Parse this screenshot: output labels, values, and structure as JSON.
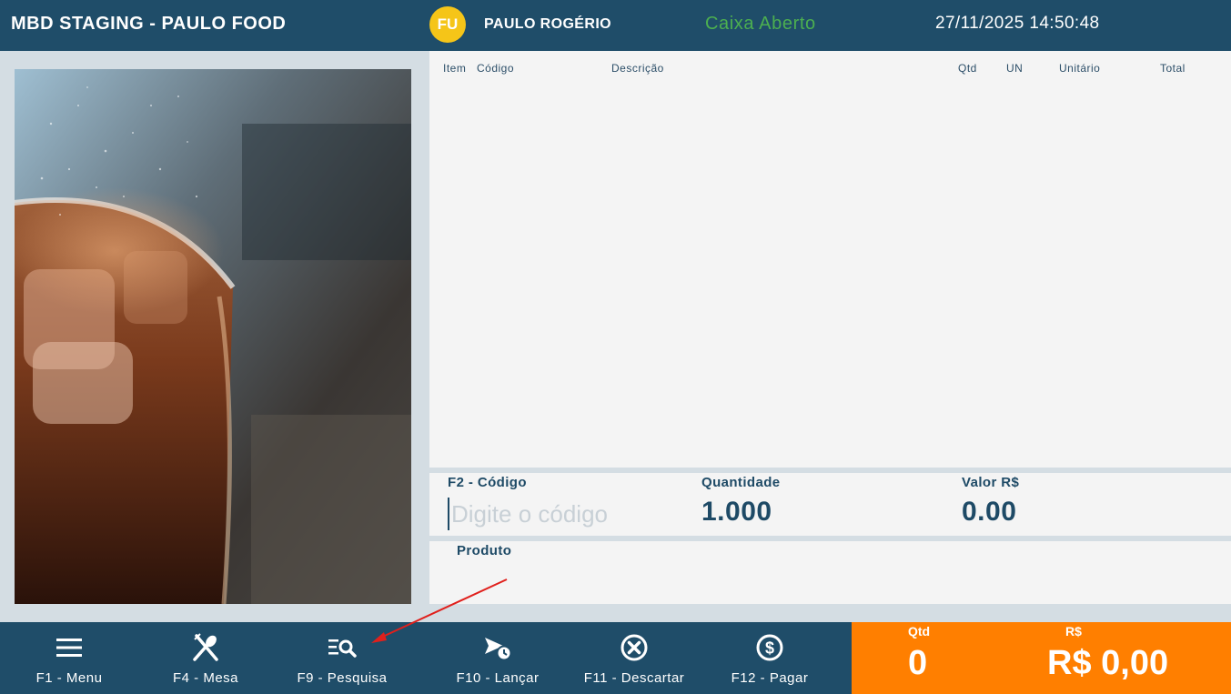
{
  "header": {
    "app_title": "MBD STAGING - PAULO FOOD",
    "avatar_initials": "FU",
    "user_name": "PAULO ROGÉRIO",
    "register_status": "Caixa Aberto",
    "datetime": "27/11/2025 14:50:48"
  },
  "table": {
    "columns": [
      "Item",
      "Código",
      "Descrição",
      "Qtd",
      "UN",
      "Unitário",
      "Total"
    ]
  },
  "entry": {
    "code_label": "F2 - Código",
    "code_placeholder": "Digite o código",
    "quantity_label": "Quantidade",
    "quantity_value": "1.000",
    "price_label": "Valor R$",
    "price_value": "0.00",
    "product_label": "Produto"
  },
  "footer": {
    "buttons": [
      {
        "label": "F1 - Menu",
        "icon": "menu-icon"
      },
      {
        "label": "F4 - Mesa",
        "icon": "fork-spoon-icon"
      },
      {
        "label": "F9 - Pesquisa",
        "icon": "list-search-icon"
      },
      {
        "label": "F10 - Lançar",
        "icon": "send-clock-icon"
      },
      {
        "label": "F11 - Descartar",
        "icon": "close-circle-icon"
      },
      {
        "label": "F12 - Pagar",
        "icon": "dollar-circle-icon"
      }
    ]
  },
  "totals": {
    "qty_caption": "Qtd",
    "qty_value": "0",
    "amount_caption": "R$",
    "amount_value": "R$ 0,00"
  },
  "colors": {
    "header_bg": "#1f4d69",
    "status_green": "#4caf50",
    "avatar_yellow": "#f5c518",
    "totals_orange": "#ff7f00",
    "annotation_red": "#e0201c"
  }
}
